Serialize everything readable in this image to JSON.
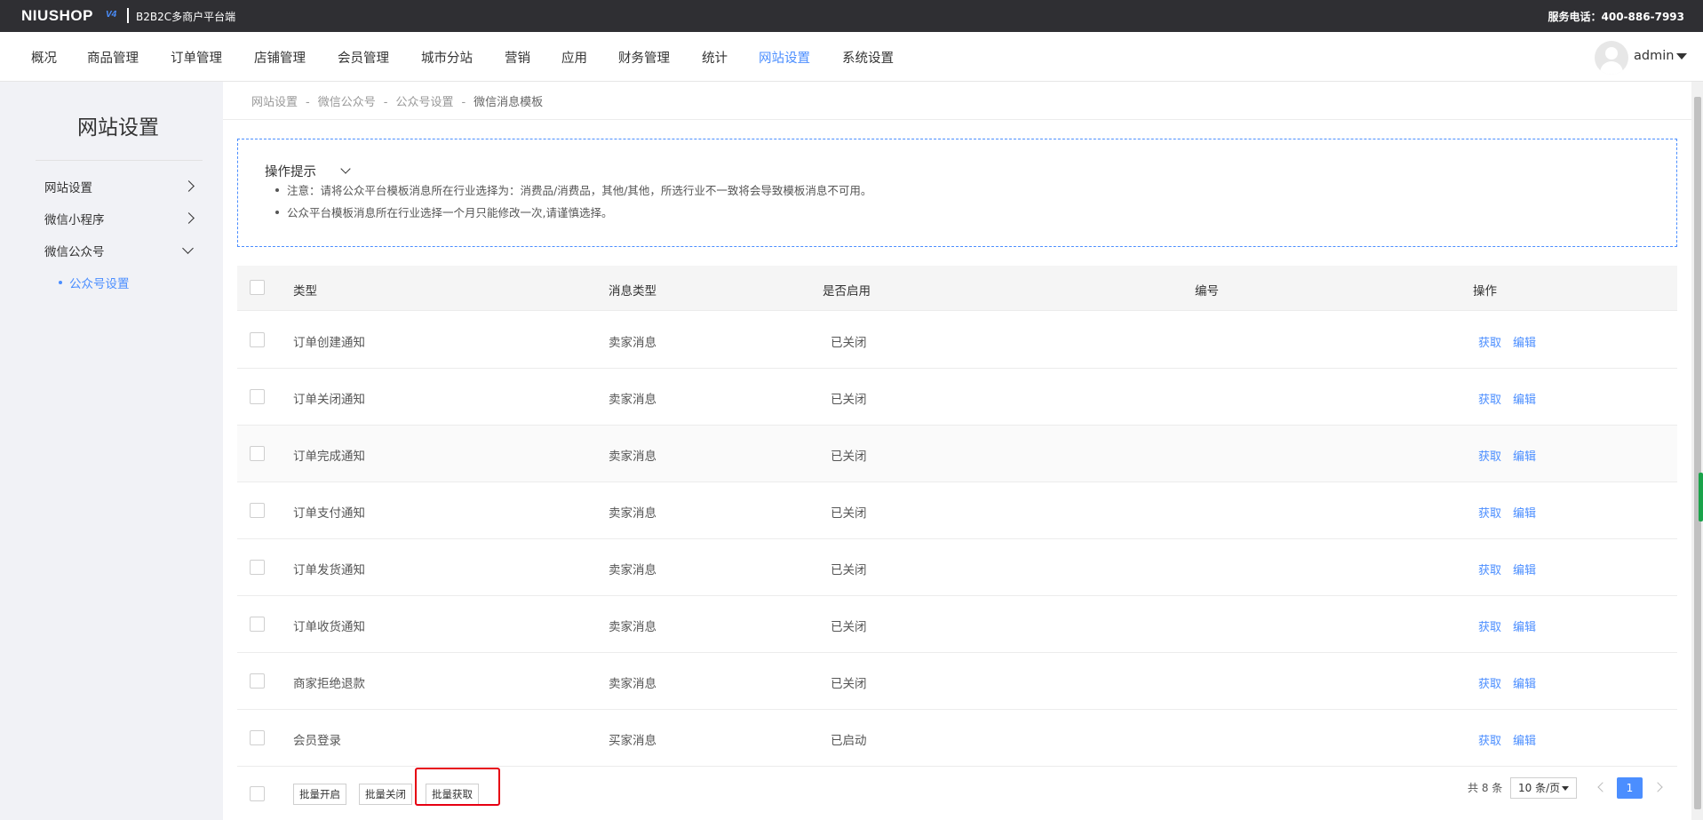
{
  "topbar": {
    "logo": "NIUSHOP",
    "logo_version": "V4",
    "platform": "B2B2C多商户平台端",
    "service": "服务电话：400-886-7993"
  },
  "nav": {
    "items": [
      "概况",
      "商品管理",
      "订单管理",
      "店铺管理",
      "会员管理",
      "城市分站",
      "营销",
      "应用",
      "财务管理",
      "统计",
      "网站设置",
      "系统设置"
    ],
    "active": "网站设置",
    "user": "admin"
  },
  "sidebar": {
    "title": "网站设置",
    "items": [
      "网站设置",
      "微信小程序",
      "微信公众号"
    ],
    "sub_item": "公众号设置"
  },
  "breadcrumb": [
    "网站设置",
    "微信公众号",
    "公众号设置",
    "微信消息模板"
  ],
  "breadcrumb_sep": "-",
  "tips": {
    "title": "操作提示",
    "lines": [
      "注意：请将公众平台模板消息所在行业选择为：消费品/消费品，其他/其他，所选行业不一致将会导致模板消息不可用。",
      "公众平台模板消息所在行业选择一个月只能修改一次,请谨慎选择。"
    ]
  },
  "table": {
    "headers": [
      "类型",
      "消息类型",
      "是否启用",
      "编号",
      "操作"
    ],
    "rows": [
      {
        "type": "订单创建通知",
        "msg_type": "卖家消息",
        "status": "已关闭",
        "code": ""
      },
      {
        "type": "订单关闭通知",
        "msg_type": "卖家消息",
        "status": "已关闭",
        "code": ""
      },
      {
        "type": "订单完成通知",
        "msg_type": "卖家消息",
        "status": "已关闭",
        "code": ""
      },
      {
        "type": "订单支付通知",
        "msg_type": "卖家消息",
        "status": "已关闭",
        "code": ""
      },
      {
        "type": "订单发货通知",
        "msg_type": "卖家消息",
        "status": "已关闭",
        "code": ""
      },
      {
        "type": "订单收货通知",
        "msg_type": "卖家消息",
        "status": "已关闭",
        "code": ""
      },
      {
        "type": "商家拒绝退款",
        "msg_type": "卖家消息",
        "status": "已关闭",
        "code": ""
      },
      {
        "type": "会员登录",
        "msg_type": "买家消息",
        "status": "已启动",
        "code": ""
      }
    ],
    "op_fetch": "获取",
    "op_edit": "编辑"
  },
  "batch": {
    "open": "批量开启",
    "close": "批量关闭",
    "fetch": "批量获取"
  },
  "pagination": {
    "total": "共 8 条",
    "page_size": "10 条/页",
    "current": "1"
  },
  "colors": {
    "accent": "#4b8eff",
    "topbar": "#2f2f33",
    "highlight": "#e60012"
  }
}
